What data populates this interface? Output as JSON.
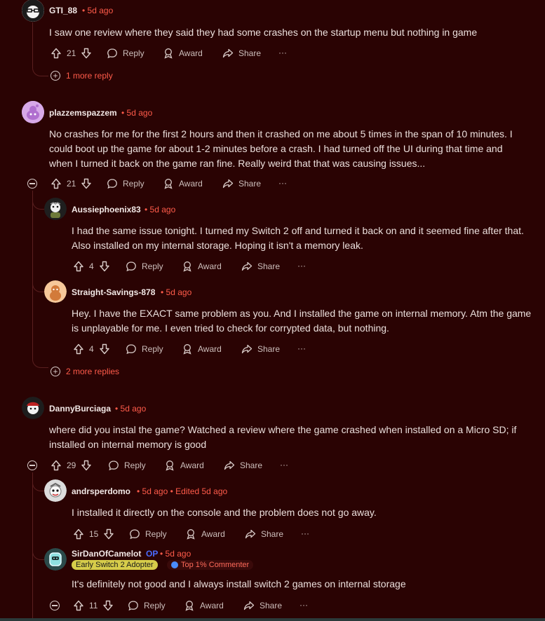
{
  "comments": [
    {
      "username": "GTI_88",
      "time": "5d ago",
      "text": "I saw one review where they said they had some crashes on the startup menu but nothing in game",
      "votes": "21",
      "more_replies": "1 more reply"
    },
    {
      "username": "plazzemspazzem",
      "time": "5d ago",
      "text": "No crashes for me for the first 2 hours and then it crashed on me about 5 times in the span of 10 minutes. I could boot up the game for about 1-2 minutes before a crash. I had turned off the UI during that time and when I turned it back on the game ran fine. Really weird that that was causing issues...",
      "votes": "21"
    },
    {
      "username": "Aussiephoenix83",
      "time": "5d ago",
      "text": "I had the same issue tonight. I turned my Switch 2 off and turned it back on and it seemed fine after that. Also installed on my internal storage. Hoping it isn't a memory leak.",
      "votes": "4"
    },
    {
      "username": "Straight-Savings-878",
      "time": "5d ago",
      "text": "Hey. I have the EXACT same problem as you. And I installed the game on internal memory. Atm the game is unplayable for me. I even tried to check for corrypted data, but nothing.",
      "votes": "4",
      "more_replies": "2 more replies"
    },
    {
      "username": "DannyBurciaga",
      "time": "5d ago",
      "text": "where did you instal the game? Watched a review where the game crashed when installed on a Micro SD; if installed on internal memory is good",
      "votes": "29"
    },
    {
      "username": "andrsperdomo",
      "time": "5d ago",
      "edited": "Edited 5d ago",
      "text": "I installed it directly on the console and the problem does not go away.",
      "votes": "15"
    },
    {
      "username": "SirDanOfCamelot",
      "op": "OP",
      "time": "5d ago",
      "flair1": "Early Switch 2 Adopter",
      "flair2": "Top 1% Commenter",
      "text": "It's definitely not good and I always install switch 2 games on internal storage",
      "votes": "11"
    }
  ],
  "actions": {
    "reply": "Reply",
    "award": "Award",
    "share": "Share",
    "overflow": "···"
  },
  "meta_sep": "•",
  "colors": {
    "background": "#2a0303",
    "accent": "#ff5b4a",
    "op": "#4a6cff",
    "flair_bg": "#d6cc4a"
  }
}
